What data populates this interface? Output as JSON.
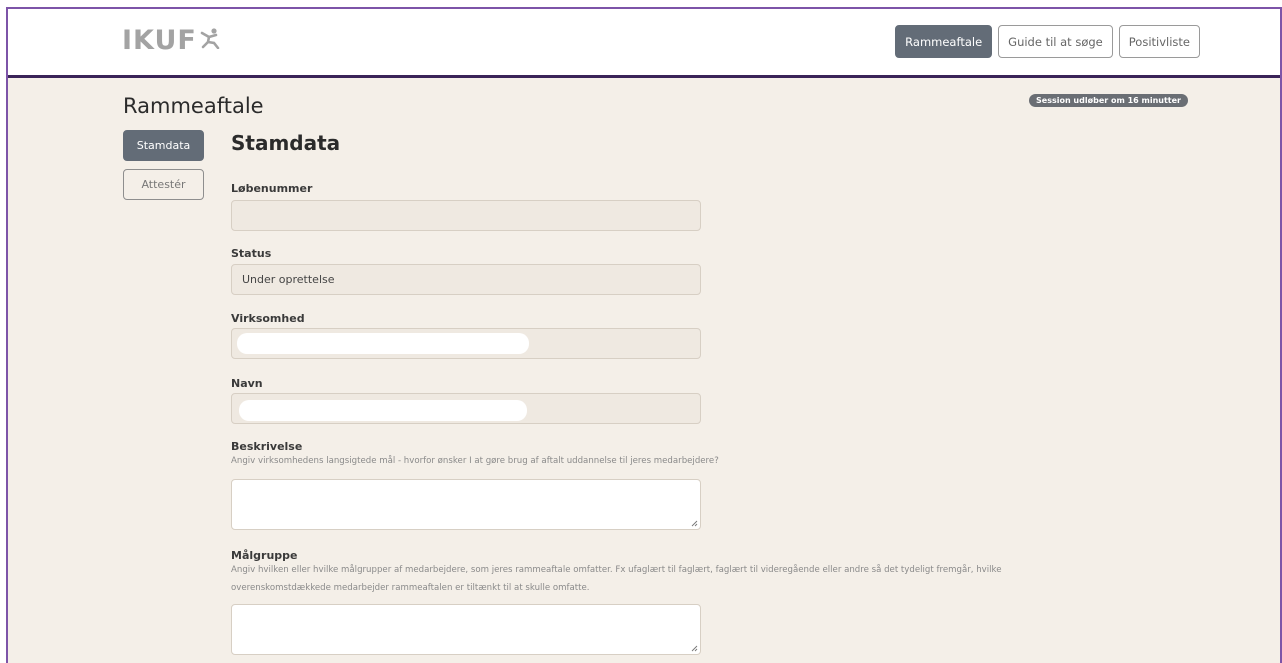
{
  "header": {
    "logo_text": "IKUF",
    "logo_icon": "person-figure-icon",
    "nav": [
      {
        "label": "Rammeaftale",
        "active": true
      },
      {
        "label": "Guide til at søge",
        "active": false
      },
      {
        "label": "Positivliste",
        "active": false
      }
    ]
  },
  "page": {
    "title": "Rammeaftale",
    "session": "Session udløber om 16 minutter"
  },
  "sidebar": {
    "items": [
      {
        "label": "Stamdata",
        "active": true
      },
      {
        "label": "Attestér",
        "active": false
      }
    ]
  },
  "form": {
    "title": "Stamdata",
    "fields": {
      "lobenummer": {
        "label": "Løbenummer",
        "value": ""
      },
      "status": {
        "label": "Status",
        "value": "Under oprettelse"
      },
      "virksomhed": {
        "label": "Virksomhed",
        "value": ""
      },
      "navn": {
        "label": "Navn",
        "value": ""
      },
      "beskrivelse": {
        "label": "Beskrivelse",
        "help": "Angiv virksomhedens langsigtede mål - hvorfor ønsker I at gøre brug af aftalt uddannelse til jeres medarbejdere?",
        "value": ""
      },
      "malgruppe": {
        "label": "Målgruppe",
        "help_line1": "Angiv hvilken eller hvilke målgrupper af medarbejdere, som jeres rammeaftale omfatter. Fx ufaglært til faglært, faglært til videregående eller andre så det tydeligt fremgår, hvilke",
        "help_line2": "overenskomstdækkede medarbejder rammeaftalen er tiltænkt til at skulle omfatte.",
        "value": ""
      }
    }
  },
  "colors": {
    "accent_border": "#7d54a8",
    "header_rule": "#3a2358",
    "active_button": "#636c77",
    "page_background": "#f4efe8"
  }
}
